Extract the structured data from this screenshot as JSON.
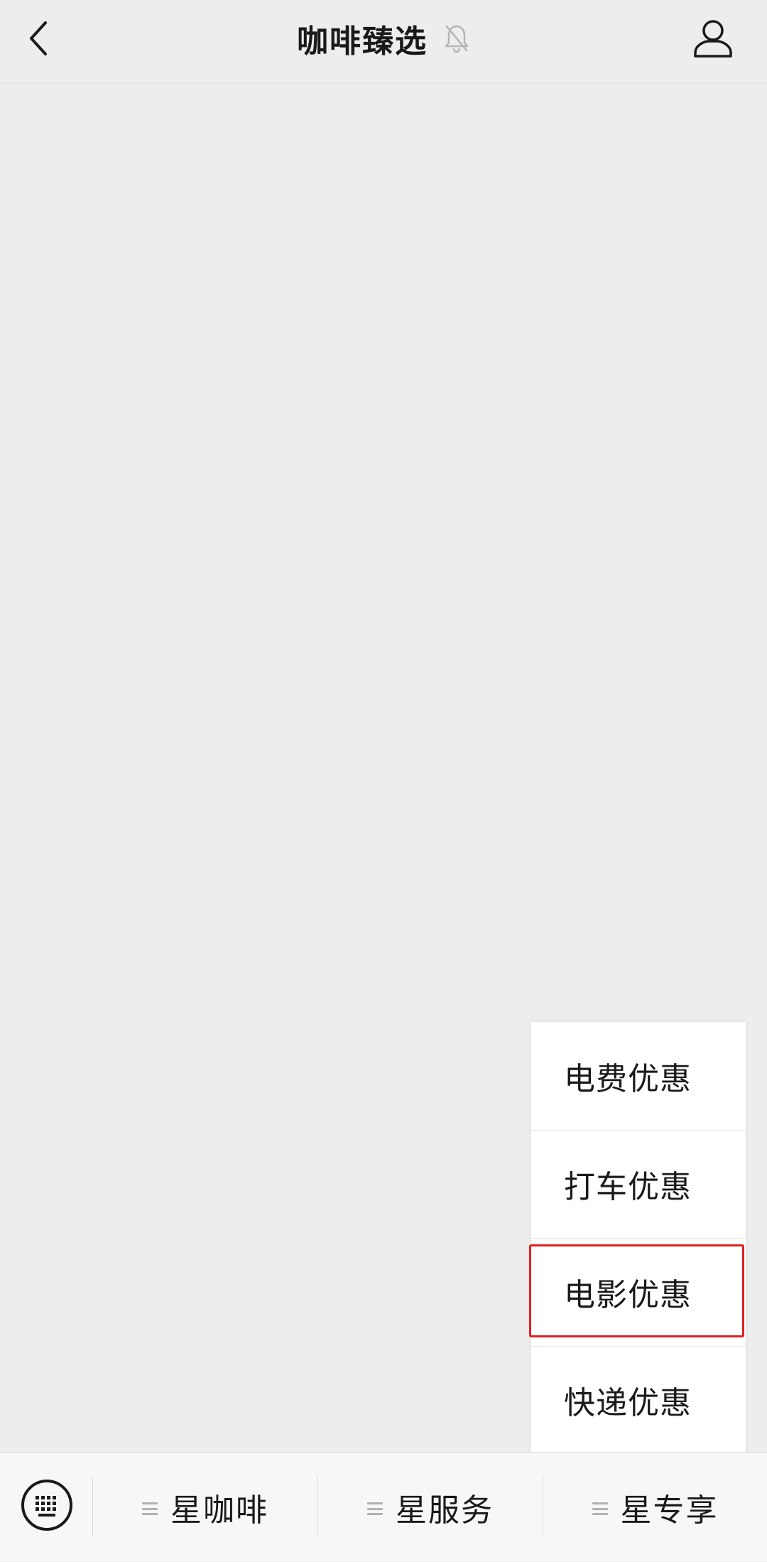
{
  "header": {
    "title": "咖啡臻选",
    "back_icon": "chevron-left-icon",
    "mute_icon": "bell-off-icon",
    "profile_icon": "person-icon"
  },
  "popup_menu": {
    "items": [
      {
        "label": "电费优惠"
      },
      {
        "label": "打车优惠"
      },
      {
        "label": "电影优惠",
        "highlighted": true
      },
      {
        "label": "快递优惠"
      }
    ],
    "highlight_color": "#e02020"
  },
  "bottom_bar": {
    "keyboard_icon": "keyboard-icon",
    "tabs": [
      {
        "label": "星咖啡",
        "icon": "menu-icon"
      },
      {
        "label": "星服务",
        "icon": "menu-icon"
      },
      {
        "label": "星专享",
        "icon": "menu-icon"
      }
    ]
  }
}
